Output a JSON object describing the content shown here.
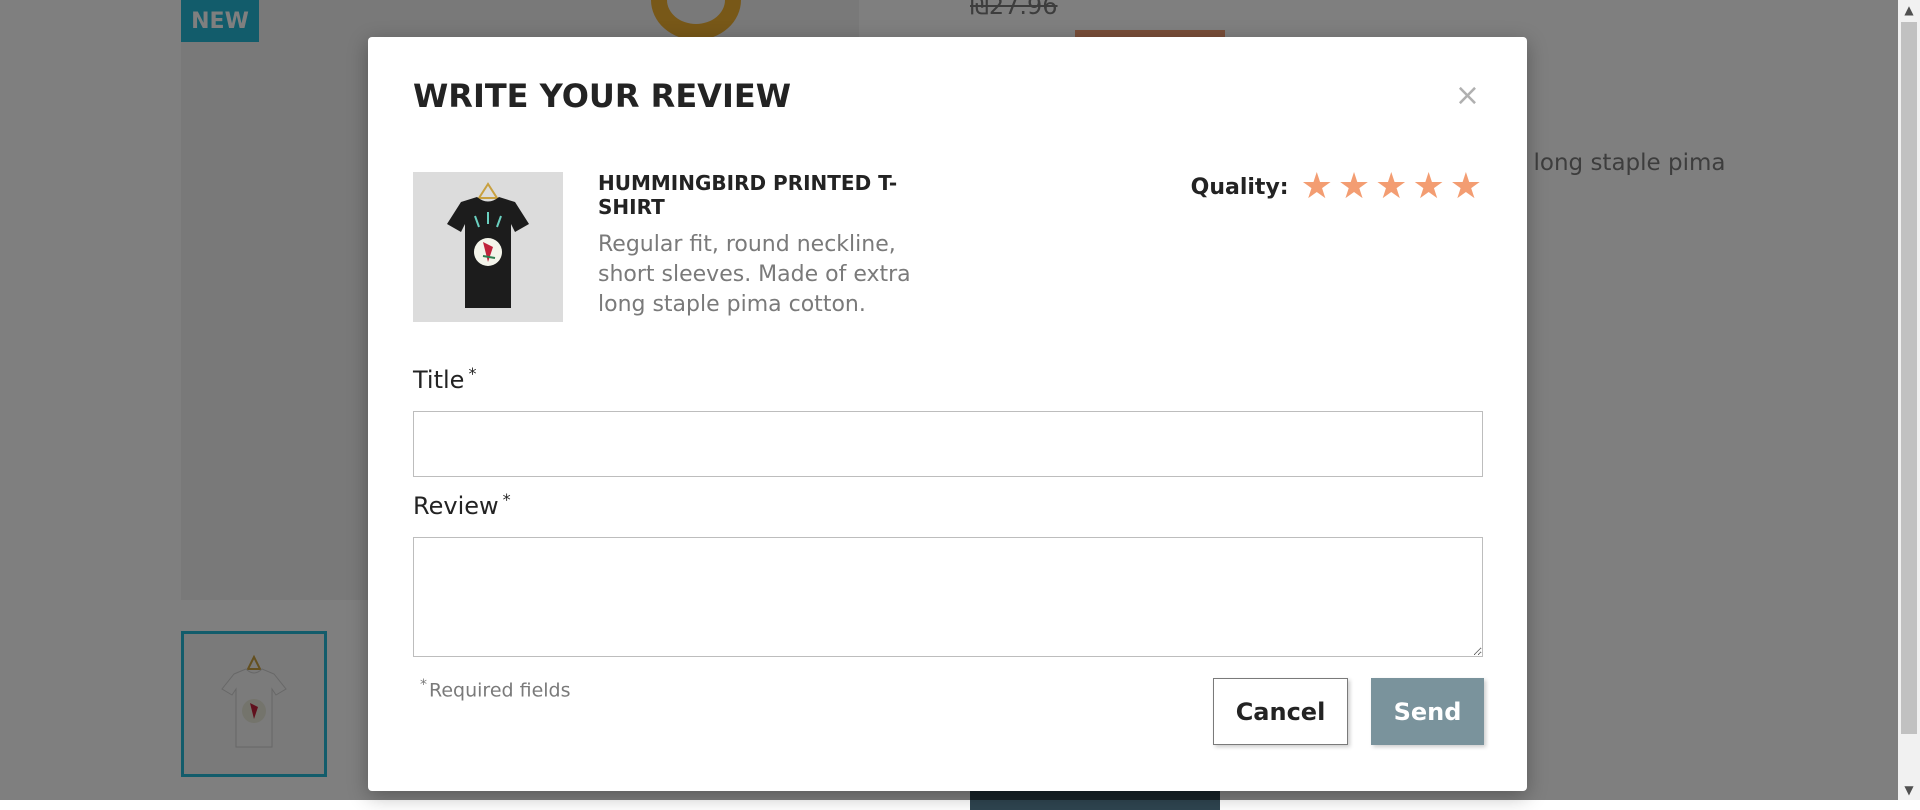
{
  "background": {
    "badge": "NEW",
    "old_price": "₪27.96",
    "description_fragment": "xtra long staple pima"
  },
  "modal": {
    "title": "WRITE YOUR REVIEW",
    "close_label": "×",
    "product": {
      "name": "HUMMINGBIRD PRINTED T-SHIRT",
      "description": "Regular fit, round neckline, short sleeves. Made of extra long staple pima cotton."
    },
    "quality": {
      "label": "Quality:",
      "rating": 5,
      "max": 5,
      "star_icon": "★",
      "star_color": "#f39d72"
    },
    "fields": {
      "title_label": "Title",
      "title_value": "",
      "review_label": "Review",
      "review_value": "",
      "required_marker": "*"
    },
    "required_note": "Required fields",
    "buttons": {
      "cancel": "Cancel",
      "send": "Send"
    }
  },
  "colors": {
    "accent": "#24b9d7",
    "send_button": "#7a939c",
    "star": "#f39d72"
  }
}
